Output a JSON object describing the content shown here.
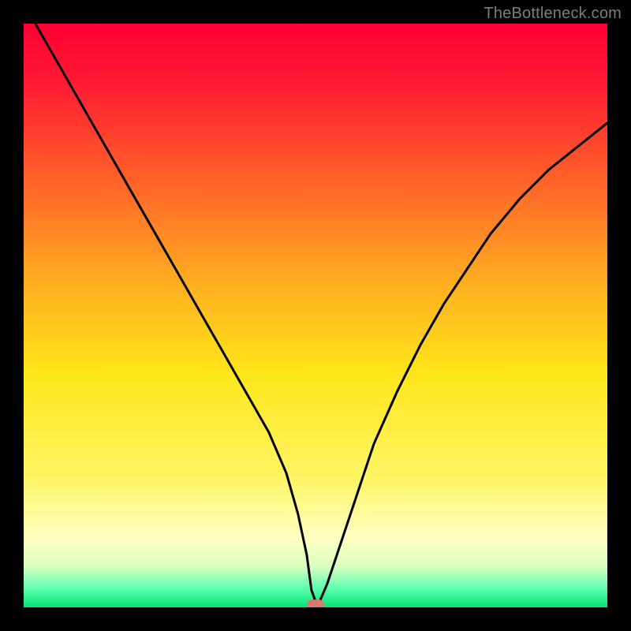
{
  "watermark": {
    "text": "TheBottleneck.com"
  },
  "chart_data": {
    "type": "line",
    "title": "",
    "xlabel": "",
    "ylabel": "",
    "xlim": [
      0,
      100
    ],
    "ylim": [
      0,
      100
    ],
    "legend": false,
    "grid": false,
    "background": {
      "type": "vertical-gradient",
      "stops": [
        {
          "pos": 0.0,
          "color": "#ff0033"
        },
        {
          "pos": 0.1,
          "color": "#ff1a33"
        },
        {
          "pos": 0.25,
          "color": "#ff5a2a"
        },
        {
          "pos": 0.45,
          "color": "#ffb020"
        },
        {
          "pos": 0.6,
          "color": "#ffe61a"
        },
        {
          "pos": 0.78,
          "color": "#fff566"
        },
        {
          "pos": 0.88,
          "color": "#ffffc0"
        },
        {
          "pos": 0.93,
          "color": "#d9ffc0"
        },
        {
          "pos": 0.965,
          "color": "#66ffb0"
        },
        {
          "pos": 1.0,
          "color": "#00e676"
        }
      ]
    },
    "series": [
      {
        "name": "bottleneck-curve",
        "color": "#000000",
        "x": [
          2,
          6,
          10,
          14,
          18,
          22,
          26,
          30,
          34,
          38,
          42,
          45,
          47,
          48.5,
          49.3,
          50,
          50.7,
          52,
          54,
          57,
          60,
          64,
          68,
          72,
          76,
          80,
          85,
          90,
          95,
          100
        ],
        "y": [
          100,
          93,
          86,
          79,
          72,
          65,
          58,
          51,
          44,
          37,
          30,
          23,
          16,
          9,
          3,
          1,
          1,
          4,
          10,
          19,
          28,
          37,
          45,
          52,
          58,
          64,
          70,
          75,
          79,
          83
        ]
      }
    ],
    "marker": {
      "name": "optimal-point",
      "x": 50,
      "y": 0.5,
      "color": "#d97a6c",
      "shape": "rounded-rect"
    }
  }
}
